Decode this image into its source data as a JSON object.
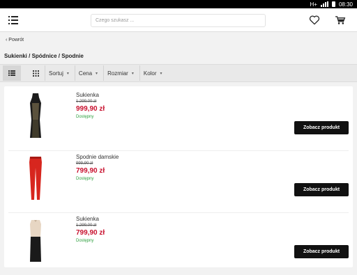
{
  "status": {
    "network": "H+",
    "time": "08:30"
  },
  "header": {
    "search_placeholder": "Czego szukasz ...",
    "icons": [
      "menu-icon",
      "heart-icon",
      "cart-icon"
    ]
  },
  "back": {
    "label": "Powrót",
    "chevron": "‹"
  },
  "breadcrumb": "Sukienki / Spódnice / Spodnie",
  "toolbar": {
    "filters": [
      {
        "label": "Sortuj"
      },
      {
        "label": "Cena"
      },
      {
        "label": "Rozmiar"
      },
      {
        "label": "Kolor"
      }
    ]
  },
  "products": [
    {
      "name": "Sukienka",
      "old_price": "1.299,00 zł",
      "price": "999,90 zł",
      "availability": "Dostępny",
      "button": "Zobacz produkt",
      "image": "black-dress"
    },
    {
      "name": "Spodnie damskie",
      "old_price": "999,90 zł",
      "price": "799,90 zł",
      "availability": "Dostępny",
      "button": "Zobacz produkt",
      "image": "red-pants"
    },
    {
      "name": "Sukienka",
      "old_price": "1.299,00 zł",
      "price": "799,90 zł",
      "availability": "Dostępny",
      "button": "Zobacz produkt",
      "image": "beige-black-dress"
    }
  ],
  "colors": {
    "price": "#c8102e",
    "available": "#2a9d3b",
    "button": "#111111"
  }
}
